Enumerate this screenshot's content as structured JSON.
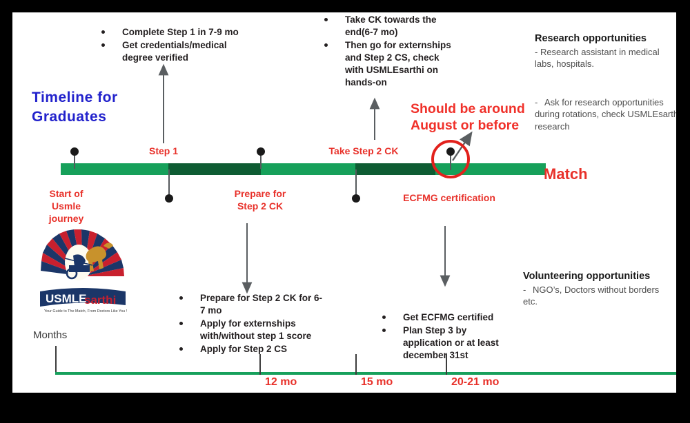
{
  "title": {
    "line1": "Timeline  for",
    "line2": "Graduates"
  },
  "top_bullets_left": [
    "Complete Step 1 in 7-9 mo",
    "Get credentials/medical degree verified"
  ],
  "top_bullets_mid": [
    "Take CK towards the end(6-7 mo)",
    "Then go for externships and Step 2 CS, check with USMLEsarthi on hands-on"
  ],
  "research": {
    "heading": "Research opportunities",
    "note": "- Research assistant in medical labs, hospitals.",
    "dash": "-",
    "item": "Ask for research opportunities during rotations, check USMLEsarthi  research"
  },
  "volunteering": {
    "heading": "Volunteering opportunities",
    "dash": "-",
    "item": "NGO’s, Doctors without  borders etc."
  },
  "callout": {
    "line1": "Should be around",
    "line2": "August or before"
  },
  "timeline": {
    "labels_above": [
      {
        "text": "Step 1"
      },
      {
        "text": "Take Step 2 CK"
      }
    ],
    "labels_below": [
      {
        "line1": "Start of",
        "line2": "Usmle",
        "line3": "journey"
      },
      {
        "line1": "Prepare for",
        "line2": "Step 2 CK"
      },
      {
        "line1": "ECFMG certification"
      }
    ],
    "match_label": "Match"
  },
  "bottom_bullets_left": [
    "Prepare for Step 2 CK for 6-7 mo",
    "Apply for externships with/without step 1 score",
    "Apply for Step 2 CS"
  ],
  "bottom_bullets_right": [
    "Get ECFMG certified",
    "Plan Step 3 by application or at least december 31st"
  ],
  "axis": {
    "caption": "Months",
    "ticks": [
      "12 mo",
      "15 mo",
      "20-21 mo"
    ]
  },
  "logo": {
    "word_usmle": "USMLE",
    "word_sarthi": "sarthi",
    "tagline": "Your Guide to The Match, From Doctors Like You !"
  },
  "colors": {
    "title_blue": "#2222cc",
    "accent_red": "#e8312a",
    "bar_light_green": "#16a05a",
    "bar_dark_green": "#0e5c33",
    "text_dark": "#231f20"
  }
}
